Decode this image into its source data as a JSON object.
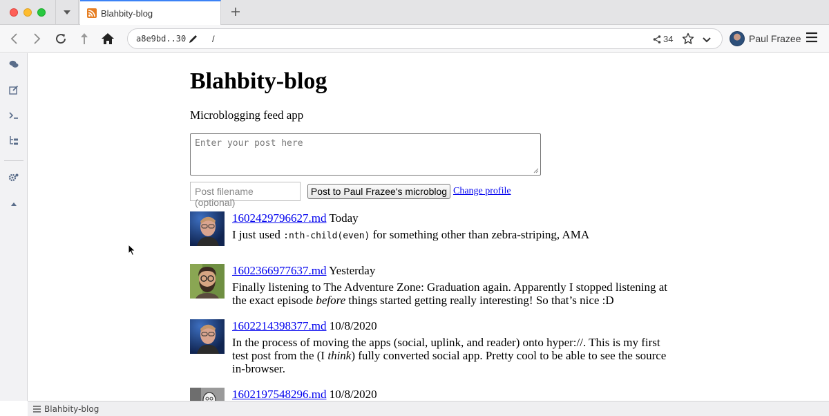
{
  "browser": {
    "tab_title": "Blahbity-blog",
    "url_key": "a8e9bd..30",
    "url_path": "/",
    "share_count": "34",
    "profile_name": "Paul Frazee",
    "status_text": "Blahbity-blog"
  },
  "page": {
    "title": "Blahbity-blog",
    "subtitle": "Microblogging feed app",
    "post_placeholder": "Enter your post here",
    "filename_placeholder": "Post filename (optional)",
    "post_button": "Post to Paul Frazee's microblog",
    "change_profile": "Change profile"
  },
  "posts": [
    {
      "filename": "1602429796627.md",
      "date": "Today",
      "text_before": "I just used ",
      "code": ":nth-child(even)",
      "text_after": " for something other than zebra-striping, AMA",
      "avatar": "paul-avatar"
    },
    {
      "filename": "1602366977637.md",
      "date": "Yesterday",
      "text_before": "Finally listening to The Adventure Zone: Graduation again. Apparently I stopped listening at the exact episode ",
      "emphasis": "before",
      "text_after": " things started getting really interesting! So that’s nice :D",
      "avatar": "bearded-avatar"
    },
    {
      "filename": "1602214398377.md",
      "date": "10/8/2020",
      "text_before": "In the process of moving the apps (social, uplink, and reader) onto hyper://. This is my first test post from the (I ",
      "emphasis": "think",
      "text_after": ") fully converted social app. Pretty cool to be able to see the source in-browser.",
      "avatar": "paul-avatar"
    },
    {
      "filename": "1602197548296.md",
      "date": "10/8/2020",
      "avatar": "sketch-avatar"
    }
  ]
}
